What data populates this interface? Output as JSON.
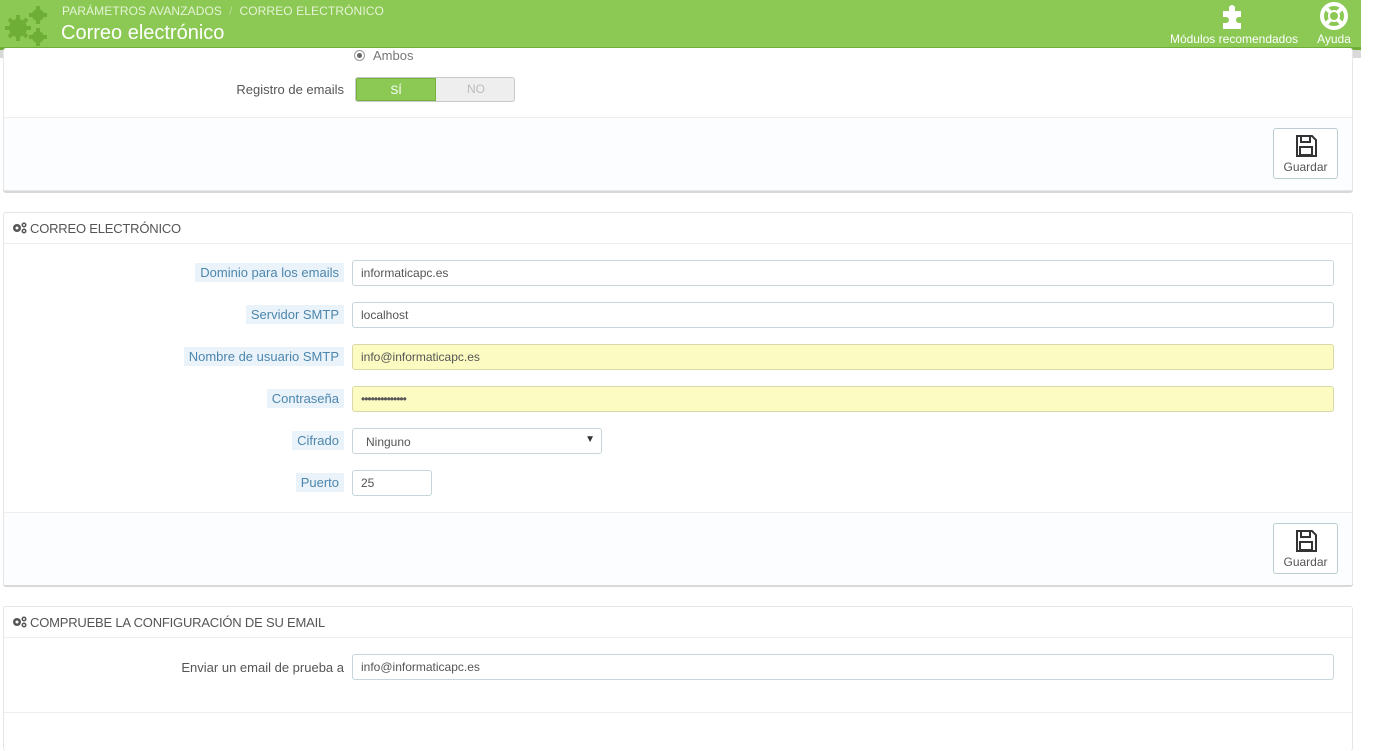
{
  "header": {
    "breadcrumb": [
      "PARÁMETROS AVANZADOS",
      "CORREO ELECTRÓNICO"
    ],
    "breadcrumb_sep": "/",
    "title": "Correo electrónico",
    "toolbar": [
      {
        "label": "Módulos recomendados",
        "icon": "puzzle-icon"
      },
      {
        "label": "Ayuda",
        "icon": "lifebuoy-icon"
      }
    ]
  },
  "panel1": {
    "radio_label": "Ambos",
    "email_log_label": "Registro de emails",
    "switch_on": "SÍ",
    "switch_off": "NO",
    "switch_value": "SÍ",
    "save_label": "Guardar"
  },
  "panel2": {
    "heading": "CORREO ELECTRÓNICO",
    "fields": [
      {
        "label": "Dominio para los emails",
        "value": "informaticapc.es"
      },
      {
        "label": "Servidor SMTP",
        "value": "localhost"
      },
      {
        "label": "Nombre de usuario SMTP",
        "value": "info@informaticapc.es"
      },
      {
        "label": "Contraseña",
        "value": "••••••••••••••"
      },
      {
        "label": "Cifrado",
        "value": "Ninguno"
      },
      {
        "label": "Puerto",
        "value": "25"
      }
    ],
    "save_label": "Guardar"
  },
  "panel3": {
    "heading": "COMPRUEBE LA CONFIGURACIÓN DE SU EMAIL",
    "test_label": "Enviar un email de prueba a",
    "test_value": "info@informaticapc.es"
  },
  "colors": {
    "header_green": "#8bc954",
    "hint_bg": "#eaf3fa",
    "hint_text": "#4d86ad",
    "autofill_yellow": "#fbfbc2"
  }
}
